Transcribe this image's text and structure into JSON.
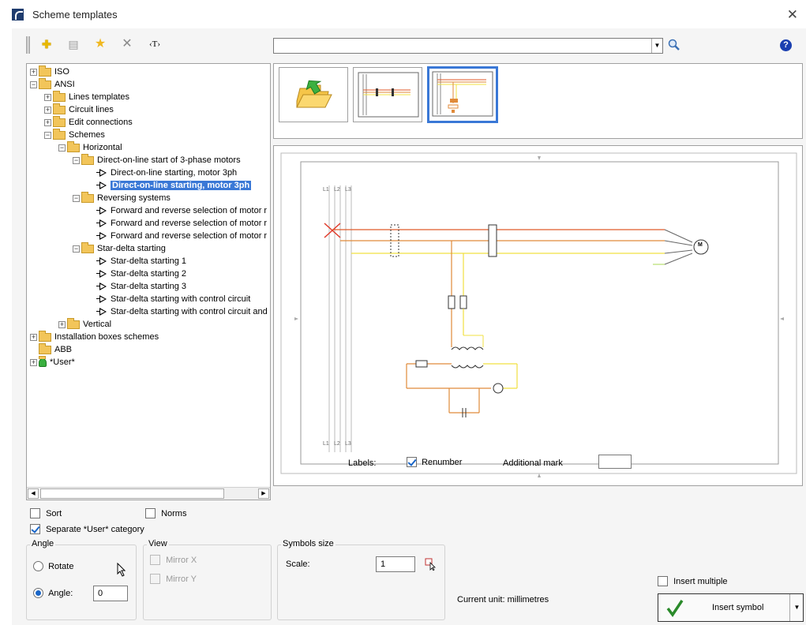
{
  "window": {
    "title": "Scheme templates",
    "close": "✕"
  },
  "toolbar": {
    "add": "✚",
    "properties": "▤",
    "favorite": "★",
    "delete": "✕",
    "text": "‹T›",
    "help": "?"
  },
  "search": {
    "value": "",
    "dropdown": "▼"
  },
  "tree": [
    {
      "label": "ISO",
      "depth": 0,
      "exp": "+",
      "kind": "folder"
    },
    {
      "label": "ANSI",
      "depth": 0,
      "exp": "−",
      "kind": "folder"
    },
    {
      "label": "Lines templates",
      "depth": 1,
      "exp": "+",
      "kind": "folder"
    },
    {
      "label": "Circuit lines",
      "depth": 1,
      "exp": "+",
      "kind": "folder"
    },
    {
      "label": "Edit connections",
      "depth": 1,
      "exp": "+",
      "kind": "folder"
    },
    {
      "label": "Schemes",
      "depth": 1,
      "exp": "−",
      "kind": "folder"
    },
    {
      "label": "Horizontal",
      "depth": 2,
      "exp": "−",
      "kind": "folder"
    },
    {
      "label": "Direct-on-line start of 3-phase motors",
      "depth": 3,
      "exp": "−",
      "kind": "folder"
    },
    {
      "label": "Direct-on-line starting, motor 3ph",
      "depth": 4,
      "exp": "",
      "kind": "symbol"
    },
    {
      "label": "Direct-on-line starting, motor 3ph",
      "depth": 4,
      "exp": "",
      "kind": "symbol-selected"
    },
    {
      "label": "Reversing systems",
      "depth": 3,
      "exp": "−",
      "kind": "folder"
    },
    {
      "label": "Forward and reverse selection of motor r",
      "depth": 4,
      "exp": "",
      "kind": "symbol"
    },
    {
      "label": "Forward and reverse selection of motor r",
      "depth": 4,
      "exp": "",
      "kind": "symbol"
    },
    {
      "label": "Forward and reverse selection of motor r",
      "depth": 4,
      "exp": "",
      "kind": "symbol"
    },
    {
      "label": "Star-delta starting",
      "depth": 3,
      "exp": "−",
      "kind": "folder"
    },
    {
      "label": "Star-delta starting 1",
      "depth": 4,
      "exp": "",
      "kind": "symbol"
    },
    {
      "label": "Star-delta starting 2",
      "depth": 4,
      "exp": "",
      "kind": "symbol"
    },
    {
      "label": "Star-delta starting 3",
      "depth": 4,
      "exp": "",
      "kind": "symbol"
    },
    {
      "label": "Star-delta starting with control circuit",
      "depth": 4,
      "exp": "",
      "kind": "symbol"
    },
    {
      "label": "Star-delta starting with control circuit and",
      "depth": 4,
      "exp": "",
      "kind": "symbol"
    },
    {
      "label": "Vertical",
      "depth": 2,
      "exp": "+",
      "kind": "folder"
    },
    {
      "label": "Installation boxes schemes",
      "depth": 0,
      "exp": "+",
      "kind": "folder"
    },
    {
      "label": "ABB",
      "depth": 0,
      "exp": "",
      "kind": "folder"
    },
    {
      "label": "*User*",
      "depth": 0,
      "exp": "+",
      "kind": "user"
    }
  ],
  "options": {
    "sort": "Sort",
    "norms": "Norms",
    "separate": "Separate *User* category"
  },
  "angle": {
    "title": "Angle",
    "rotate": "Rotate",
    "angle_label": "Angle:",
    "angle_value": "0"
  },
  "view": {
    "title": "View",
    "mirror_x": "Mirror X",
    "mirror_y": "Mirror Y"
  },
  "symbols_size": {
    "title": "Symbols size",
    "scale_label": "Scale:",
    "scale_value": "1"
  },
  "preview": {
    "labels": "Labels:",
    "renumber": "Renumber",
    "additional_mark": "Additional mark",
    "rail_labels_top": [
      "L1",
      "L2",
      "L3"
    ],
    "rail_labels_bottom": [
      "L1",
      "L2",
      "L3"
    ],
    "motor": "M"
  },
  "footer": {
    "current_unit": "Current unit: millimetres",
    "insert_multiple": "Insert multiple",
    "insert_symbol": "Insert symbol"
  },
  "colors": {
    "accent": "#3a78d6",
    "line_red": "#e05a2a",
    "line_orange": "#e08a3a",
    "line_yellow": "#f0e040",
    "line_green": "#b8e070"
  }
}
